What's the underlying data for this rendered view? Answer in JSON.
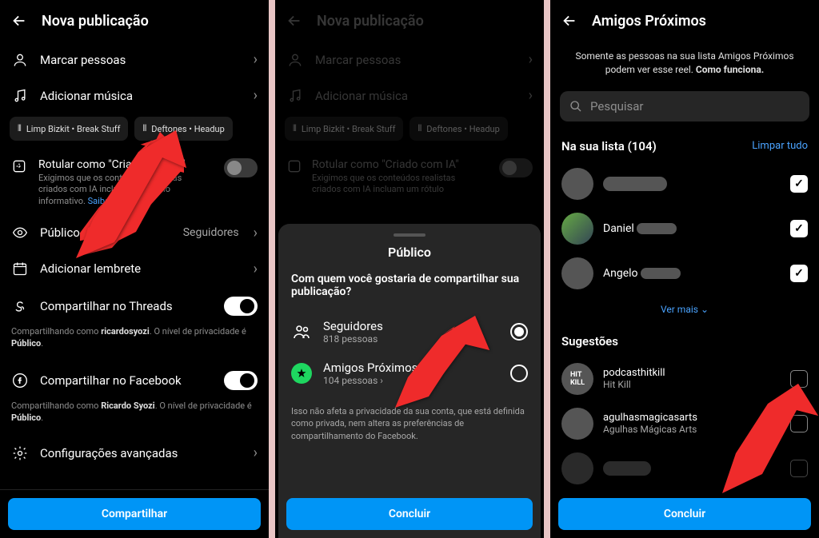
{
  "screen1": {
    "title": "Nova publicação",
    "tag_people": "Marcar pessoas",
    "add_music": "Adicionar música",
    "music_chip1": "Limp Bizkit • Break Stuff",
    "music_chip2": "Deftones • Headup",
    "ai_label": "Rotular como \"Criado com IA\"",
    "ai_desc": "Exigimos que os conteúdos realistas criados com IA incluam um rótulo informativo. ",
    "ai_link": "Saiba mais.",
    "audience_label": "Público",
    "audience_value": "Seguidores",
    "reminder": "Adicionar lembrete",
    "threads": "Compartilhar no Threads",
    "threads_desc_prefix": "Compartilhando como ",
    "threads_user": "ricardosyozi",
    "threads_desc_suffix": ". O nível de privacidade é ",
    "threads_priv": "Público",
    "facebook": "Compartilhar no Facebook",
    "fb_user": "Ricardo Syozi",
    "advanced": "Configurações avançadas",
    "share_btn": "Compartilhar"
  },
  "screen2": {
    "title": "Nova publicação",
    "tag_people": "Marcar pessoas",
    "add_music": "Adicionar música",
    "music_chip1": "Limp Bizkit • Break Stuff",
    "music_chip2": "Deftones • Headup",
    "ai_label": "Rotular como \"Criado com IA\"",
    "ai_desc": "Exigimos que os conteúdos realistas criados com IA incluam um rótulo",
    "sheet_title": "Público",
    "sheet_q": "Com quem você gostaria de compartilhar sua publicação?",
    "opt1_label": "Seguidores",
    "opt1_sub": "818 pessoas",
    "opt2_label": "Amigos Próximos",
    "opt2_sub": "104 pessoas",
    "disclaimer": "Isso não afeta a privacidade da sua conta, que está definida como privada, nem altera as preferências de compartilhamento do Facebook.",
    "done_btn": "Concluir"
  },
  "screen3": {
    "title": "Amigos Próximos",
    "info": "Somente as pessoas na sua lista Amigos Próximos podem ver esse reel. ",
    "info_link": "Como funciona.",
    "search_placeholder": "Pesquisar",
    "list_title": "Na sua lista (104)",
    "clear_all": "Limpar tudo",
    "person2_name": "Daniel",
    "person3_name": "Angelo",
    "ver_mais": "Ver mais",
    "suggestions": "Sugestões",
    "sug1_user": "podcasthitkill",
    "sug1_name": "Hit Kill",
    "sug2_user": "agulhasmagicasarts",
    "sug2_name": "Agulhas Mágicas Arts",
    "done_btn": "Concluir"
  }
}
